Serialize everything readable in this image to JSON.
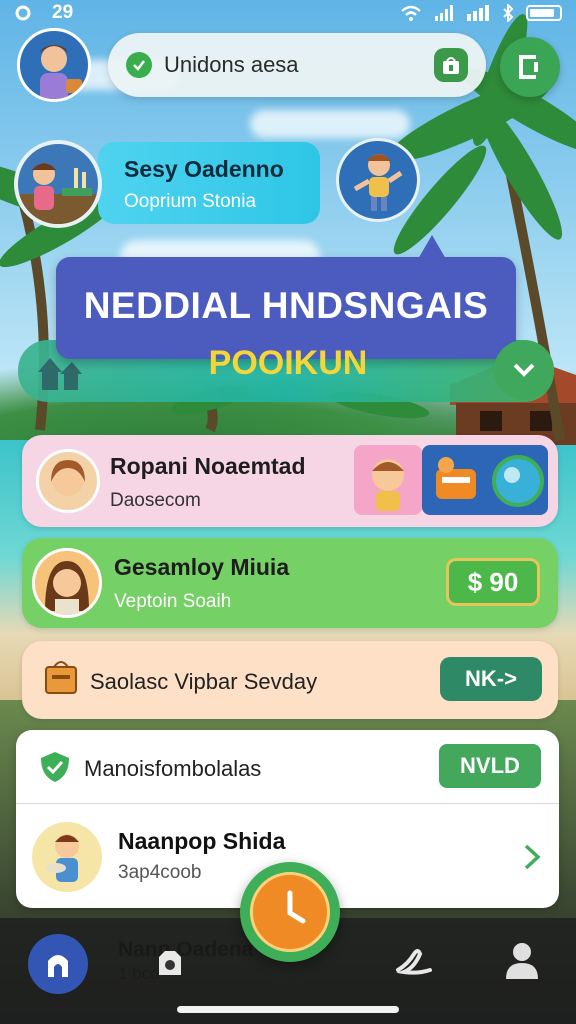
{
  "status_bar": {
    "left_icon": "settings-ring-icon",
    "time": "29",
    "icons": [
      "wifi-icon",
      "signal-icon",
      "signal-bars-icon",
      "bluetooth-icon",
      "battery-icon"
    ]
  },
  "search": {
    "text": "Unidons aesa",
    "left_icon": "chat-bubble-icon",
    "right_icon": "shop-bag-icon"
  },
  "top_action_icon": "exit-door-icon",
  "profile": {
    "name": "Sesy Oadenno",
    "subtitle": "Ooprium Stonia"
  },
  "banner": {
    "title": "NEDDIAL HNDSNGAIS",
    "subtitle": "POOIKUN"
  },
  "cards": [
    {
      "title": "Ropani Noaemtad",
      "subtitle": "Daosecom"
    },
    {
      "title": "Gesamloy Miuia",
      "subtitle": "Veptoin Soaih",
      "price": "$ 90"
    },
    {
      "title": "Saolasc Vipbar Sevday",
      "button": "NK->"
    }
  ],
  "panel": {
    "row1": {
      "title": "Manoisfombolalas",
      "button": "NVLD"
    },
    "row2": {
      "title": "Naanpop Shida",
      "subtitle": "3ap4coob"
    }
  },
  "bottom_nav": {
    "ghost_title": "Nanp Oadena",
    "ghost_subtitle": "1 bco",
    "items": [
      "home-icon",
      "robot-icon",
      "clock-icon",
      "signature-icon",
      "profile-icon"
    ]
  },
  "colors": {
    "accent_green": "#3fae58",
    "banner_blue": "#4c5bbe",
    "banner_yellow": "#f4d53a",
    "profile_cyan": "#2ec6e6"
  }
}
